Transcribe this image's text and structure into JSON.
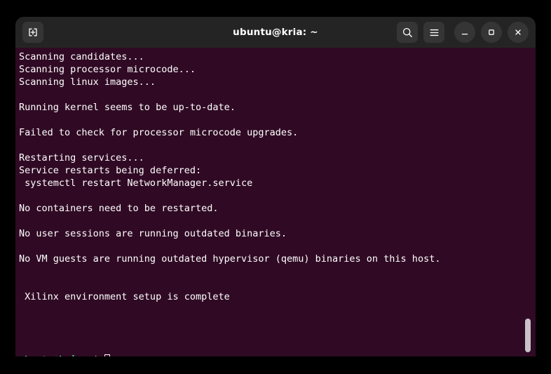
{
  "window": {
    "title": "ubuntu@kria: ~",
    "background_color": "#300a24",
    "header_color": "#242424",
    "desktop_color": "#000000"
  },
  "titlebar": {
    "new_tab_label": "New Tab",
    "search_label": "Search",
    "menu_label": "Main Menu",
    "minimize_label": "Minimize",
    "maximize_label": "Maximize",
    "close_label": "Close"
  },
  "terminal": {
    "lines": [
      "Scanning candidates...",
      "Scanning processor microcode...",
      "Scanning linux images...",
      "",
      "Running kernel seems to be up-to-date.",
      "",
      "Failed to check for processor microcode upgrades.",
      "",
      "Restarting services...",
      "Service restarts being deferred:",
      " systemctl restart NetworkManager.service",
      "",
      "No containers need to be restarted.",
      "",
      "No user sessions are running outdated binaries.",
      "",
      "No VM guests are running outdated hypervisor (qemu) binaries on this host.",
      "",
      "",
      " Xilinx environment setup is complete",
      "",
      "",
      "",
      ""
    ],
    "prompt": {
      "user_host": "ubuntu@kria",
      "path": ":~",
      "symbol": "$",
      "input_value": ""
    },
    "colors": {
      "user_host": "#4ee08a",
      "path": "#6a8fe0",
      "symbol": "#ffffff",
      "text": "#ffffff"
    }
  },
  "scrollbar": {
    "thumb_color": "#c8c3c8",
    "position_label": "bottom"
  }
}
